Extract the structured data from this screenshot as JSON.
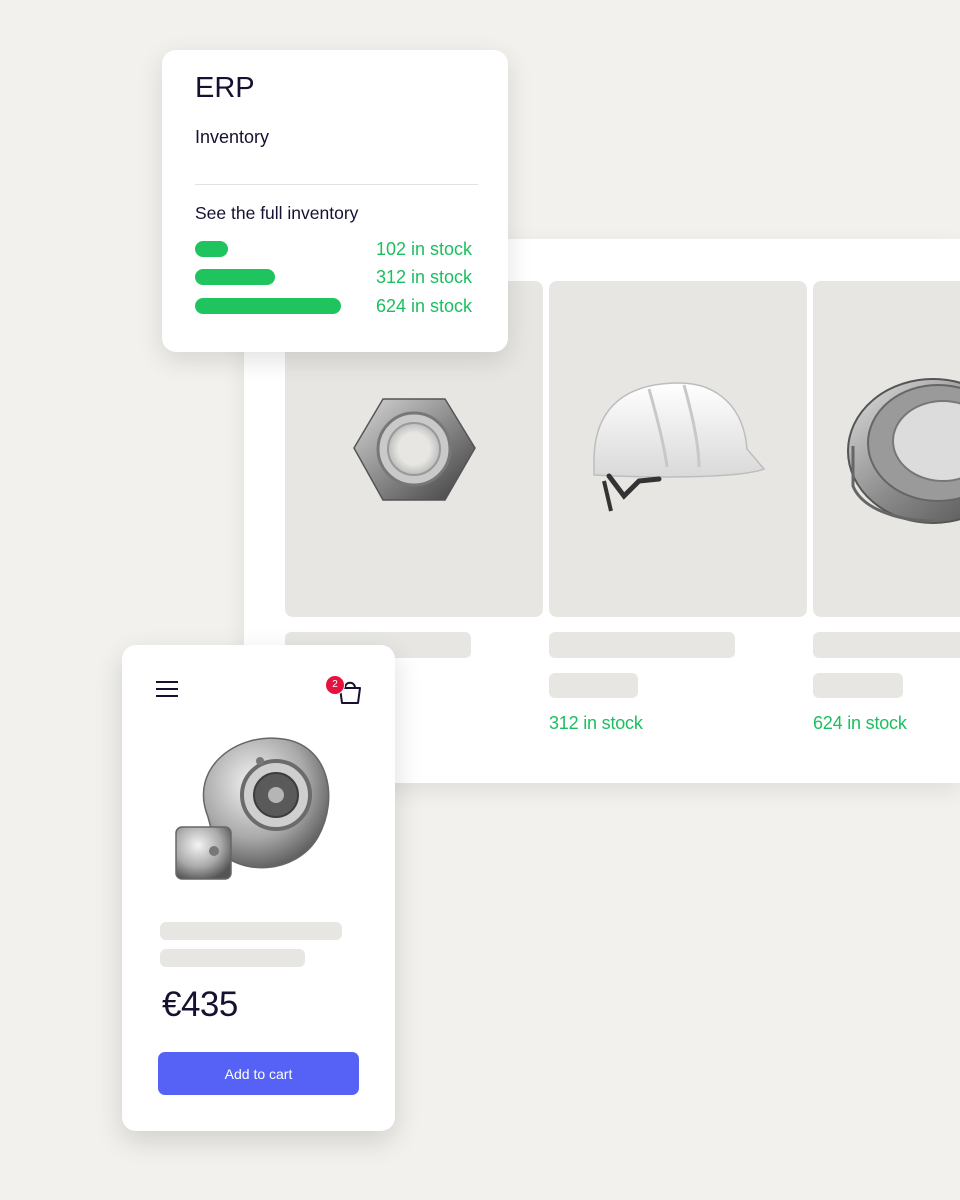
{
  "erp_card": {
    "title": "ERP",
    "subtitle": "Inventory",
    "link": "See the full inventory",
    "stock_rows": [
      {
        "label": "102 in stock",
        "count": 102
      },
      {
        "label": "312 in stock",
        "count": 312
      },
      {
        "label": "624 in stock",
        "count": 624
      }
    ]
  },
  "catalog": {
    "products": [
      {
        "image": "hex-nut-icon"
      },
      {
        "image": "hard-hat-icon",
        "stock": "312 in stock"
      },
      {
        "image": "bearing-icon",
        "stock": "624 in stock"
      }
    ]
  },
  "mobile": {
    "menu_icon": "hamburger-menu-icon",
    "cart_icon": "shopping-bag-icon",
    "cart_count": "2",
    "product_image": "turbocharger-icon",
    "price": "€435",
    "add_to_cart": "Add to cart"
  },
  "colors": {
    "stock_green": "#1bbf5f",
    "primary_button": "#5562f5",
    "badge_red": "#e4143f",
    "background": "#f2f1ed"
  }
}
